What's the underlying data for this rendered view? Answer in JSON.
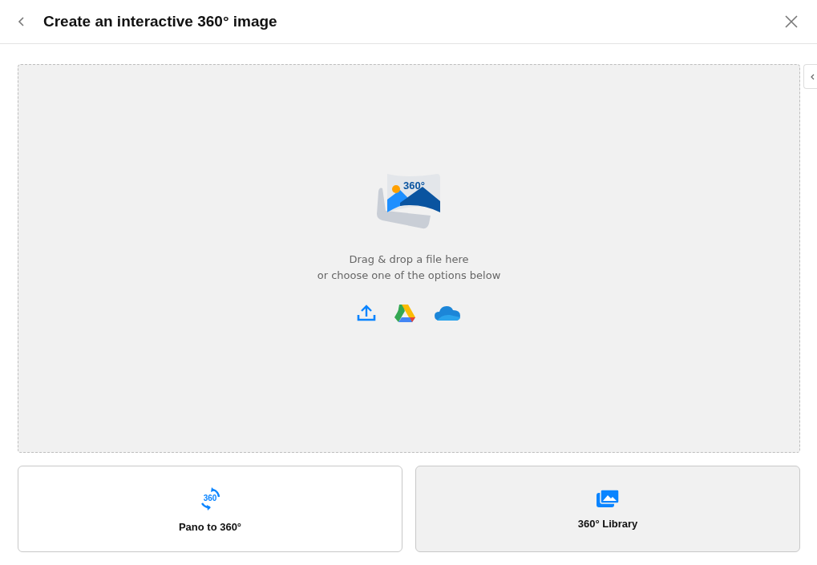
{
  "header": {
    "title": "Create an interactive 360° image"
  },
  "dropzone": {
    "badge": "360°",
    "lines": [
      "Drag & drop a file here",
      "or choose one of the options below"
    ],
    "sources": [
      {
        "kind": "upload"
      },
      {
        "kind": "drive"
      },
      {
        "kind": "cloud"
      }
    ]
  },
  "options": [
    {
      "kind": "pano",
      "icon_text": "360",
      "label": "Pano to 360°",
      "selected": false
    },
    {
      "kind": "library",
      "label": "360° Library",
      "selected": true
    }
  ]
}
